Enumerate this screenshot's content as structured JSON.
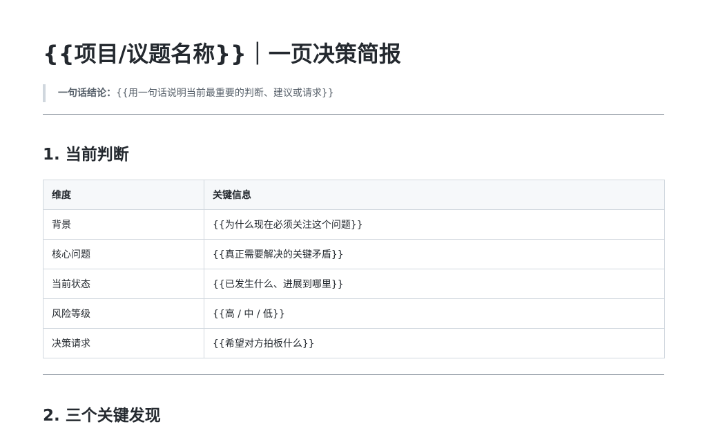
{
  "document": {
    "title": "{{项目/议题名称}}｜一页决策简报",
    "summary": {
      "label": "一句话结论：",
      "text": "{{用一句话说明当前最重要的判断、建议或请求}}"
    },
    "sections": [
      {
        "heading": "1. 当前判断",
        "table": {
          "headers": [
            "维度",
            "关键信息"
          ],
          "rows": [
            [
              "背景",
              "{{为什么现在必须关注这个问题}}"
            ],
            [
              "核心问题",
              "{{真正需要解决的关键矛盾}}"
            ],
            [
              "当前状态",
              "{{已发生什么、进展到哪里}}"
            ],
            [
              "风险等级",
              "{{高 / 中 / 低}}"
            ],
            [
              "决策请求",
              "{{希望对方拍板什么}}"
            ]
          ]
        }
      },
      {
        "heading": "2. 三个关键发现"
      }
    ]
  }
}
